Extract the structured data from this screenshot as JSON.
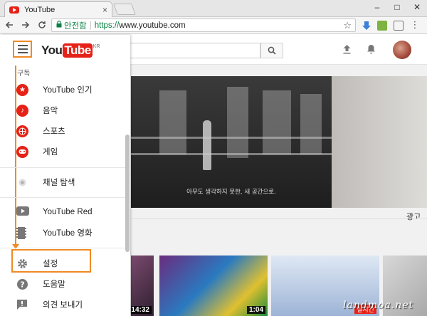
{
  "browser": {
    "tab_title": "YouTube",
    "tab_close": "×",
    "window_controls": [
      "–",
      "□",
      "✕"
    ],
    "back_icon": "arrow-left-icon",
    "forward_icon": "arrow-right-icon",
    "reload_icon": "reload-icon",
    "security_label": "안전함",
    "url_scheme": "https://",
    "url_host": "www.youtube.com"
  },
  "logo": {
    "you": "You",
    "tube": "Tube",
    "region": "KR"
  },
  "guide": {
    "section_label": "구독",
    "items": [
      {
        "label": "YouTube 인기",
        "icon": "star-icon"
      },
      {
        "label": "음악",
        "icon": "music-note-icon"
      },
      {
        "label": "스포츠",
        "icon": "basketball-icon"
      },
      {
        "label": "게임",
        "icon": "gamepad-icon"
      },
      {
        "label": "채널 탐색",
        "icon": "plus-circle-icon"
      },
      {
        "label": "YouTube Red",
        "icon": "youtube-red-icon"
      },
      {
        "label": "YouTube 영화",
        "icon": "film-icon"
      },
      {
        "label": "설정",
        "icon": "gear-icon"
      },
      {
        "label": "도움말",
        "icon": "help-icon"
      },
      {
        "label": "의견 보내기",
        "icon": "feedback-icon"
      }
    ]
  },
  "main": {
    "player_subtitle": "아무도 생각하지 못한, 새 공간으로.",
    "ad_label": "광고",
    "thumbnails": [
      {
        "duration": "14:32"
      },
      {
        "duration": "1:04"
      },
      {
        "badge": "실시간"
      }
    ]
  },
  "watermark": "landmoa.net",
  "colors": {
    "youtube_red": "#e62117",
    "annotation_orange": "#f08a24",
    "secure_green": "#0b8043"
  }
}
